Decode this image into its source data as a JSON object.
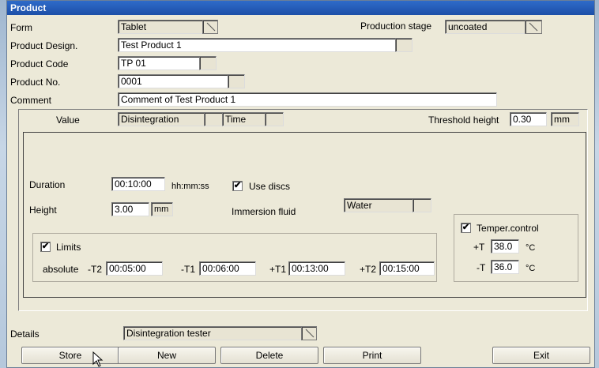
{
  "window": {
    "title": "Product"
  },
  "form": {
    "label": "Form",
    "value": "Tablet"
  },
  "production_stage": {
    "label": "Production stage",
    "value": "uncoated"
  },
  "product_design": {
    "label": "Product Design.",
    "value": "Test Product 1"
  },
  "product_code": {
    "label": "Product Code",
    "value": "TP 01"
  },
  "product_no": {
    "label": "Product No.",
    "value": "0001"
  },
  "comment": {
    "label": "Comment",
    "value": "Comment of Test Product 1"
  },
  "value_row": {
    "label": "Value",
    "value_type": "Disintegration",
    "mode": "Time",
    "threshold_label": "Threshold height",
    "threshold_value": "0.30",
    "threshold_unit": "mm"
  },
  "duration": {
    "label": "Duration",
    "value": "00:10:00",
    "unit": "hh:mm:ss"
  },
  "use_discs": {
    "label": "Use discs",
    "checked": true
  },
  "height": {
    "label": "Height",
    "value": "3.00",
    "unit": "mm"
  },
  "immersion_fluid": {
    "label": "Immersion fluid",
    "value": "Water"
  },
  "limits": {
    "label": "Limits",
    "checked": true,
    "absolute_label": "absolute",
    "t2_minus_label": "-T2",
    "t2_minus": "00:05:00",
    "t1_minus_label": "-T1",
    "t1_minus": "00:06:00",
    "t1_plus_label": "+T1",
    "t1_plus": "00:13:00",
    "t2_plus_label": "+T2",
    "t2_plus": "00:15:00"
  },
  "temper_control": {
    "label": "Temper.control",
    "checked": true,
    "plus_t_label": "+T",
    "plus_t": "38.0",
    "minus_t_label": "-T",
    "minus_t": "36.0",
    "unit": "°C"
  },
  "details": {
    "label": "Details",
    "value": "Disintegration tester"
  },
  "buttons": {
    "store": "Store",
    "new": "New",
    "delete": "Delete",
    "print": "Print",
    "exit": "Exit"
  },
  "check_mark": "✔"
}
